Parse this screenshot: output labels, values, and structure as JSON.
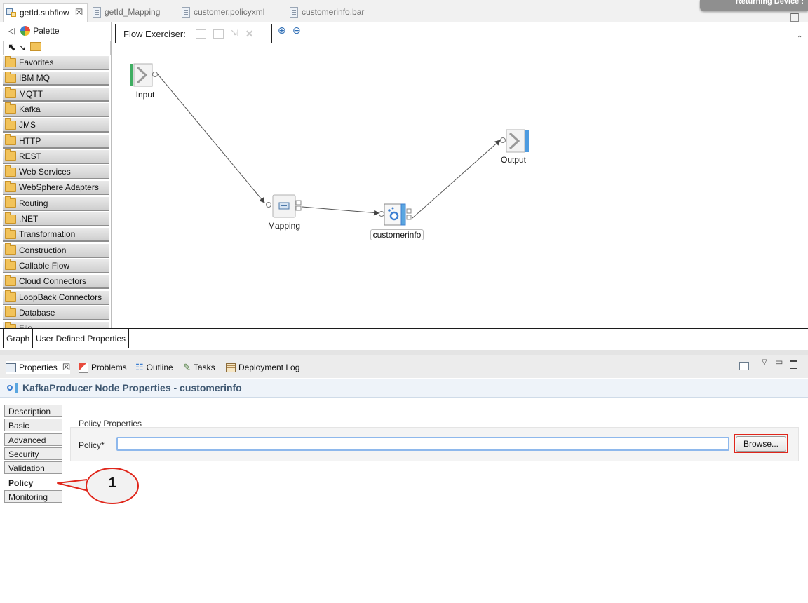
{
  "editor_tabs": [
    {
      "label": "getId.subflow",
      "active": true,
      "close": "☒"
    },
    {
      "label": "getId_Mapping",
      "active": false
    },
    {
      "label": "customer.policyxml",
      "active": false
    },
    {
      "label": "customerinfo.bar",
      "active": false
    }
  ],
  "tooltip": "Returning Device :",
  "palette": {
    "title": "Palette",
    "drawers": [
      "Favorites",
      "IBM MQ",
      "MQTT",
      "Kafka",
      "JMS",
      "HTTP",
      "REST",
      "Web Services",
      "WebSphere Adapters",
      "Routing",
      ".NET",
      "Transformation",
      "Construction",
      "Callable Flow",
      "Cloud Connectors",
      "LoopBack Connectors",
      "Database",
      "File"
    ]
  },
  "flow_exerciser": {
    "label": "Flow Exerciser:"
  },
  "nodes": {
    "input": "Input",
    "mapping": "Mapping",
    "customerinfo": "customerinfo",
    "output": "Output"
  },
  "graph_tabs": [
    "Graph",
    "User Defined Properties"
  ],
  "view_tabs": [
    {
      "label": "Properties",
      "active": true,
      "close": "☒"
    },
    {
      "label": "Problems"
    },
    {
      "label": "Outline"
    },
    {
      "label": "Tasks"
    },
    {
      "label": "Deployment Log"
    }
  ],
  "properties": {
    "title": "KafkaProducer Node Properties - customerinfo",
    "side_tabs": [
      "Description",
      "Basic",
      "Advanced",
      "Security",
      "Validation",
      "Policy",
      "Monitoring"
    ],
    "active_tab": "Policy",
    "section_title": "Policy Properties",
    "policy_label": "Policy*",
    "policy_value": "",
    "browse_label": "Browse..."
  },
  "annotation": {
    "number": "1",
    "color": "#e0261b"
  }
}
